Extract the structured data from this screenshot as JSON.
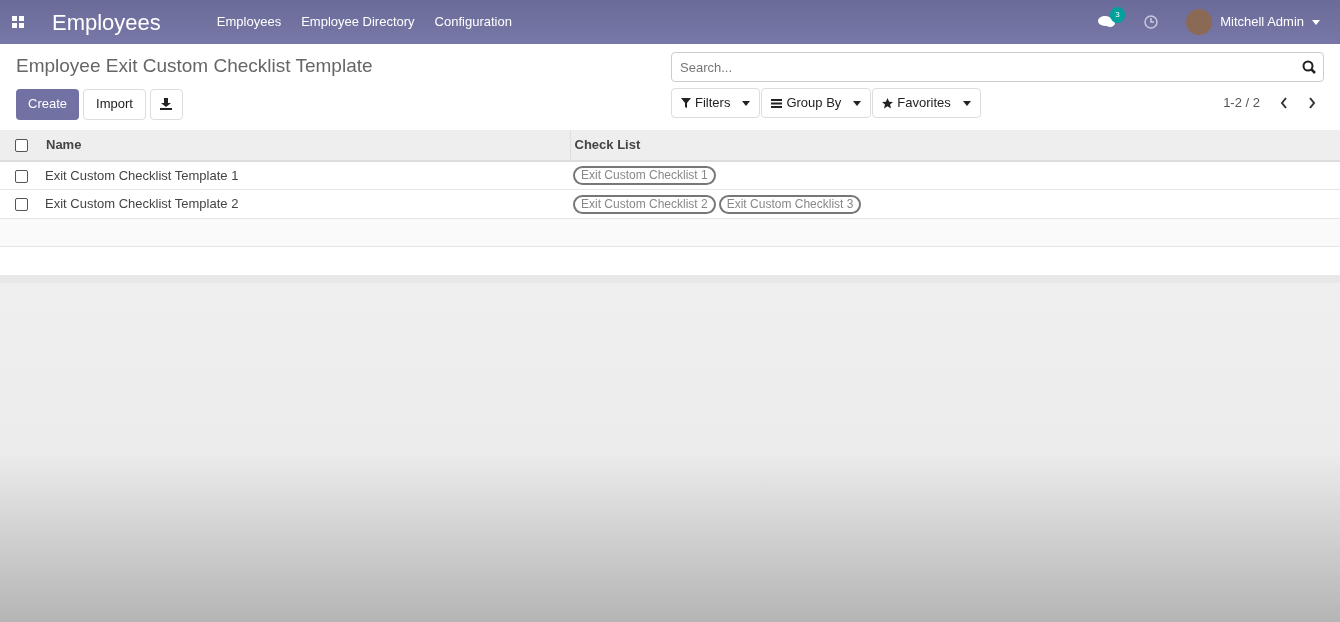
{
  "navbar": {
    "app_title": "Employees",
    "menu": [
      "Employees",
      "Employee Directory",
      "Configuration"
    ],
    "message_count": "3",
    "user": "Mitchell Admin"
  },
  "control_panel": {
    "title": "Employee Exit Custom Checklist Template",
    "buttons": [
      "Create",
      "Import"
    ],
    "search": {
      "placeholder": "Search..."
    },
    "filters": [
      "Filters",
      "Group By",
      "Favorites"
    ],
    "pager": "1-2 / 2"
  },
  "table": {
    "select_all_checked": false,
    "columns": [
      "Name",
      "Check List"
    ],
    "rows": [
      {
        "checked": false,
        "name": "Exit Custom Checklist Template 1",
        "tags": [
          "Exit Custom Checklist 1"
        ]
      },
      {
        "checked": false,
        "name": "Exit Custom Checklist Template 2",
        "tags": [
          "Exit Custom Checklist 2",
          "Exit Custom Checklist 3"
        ]
      }
    ]
  }
}
